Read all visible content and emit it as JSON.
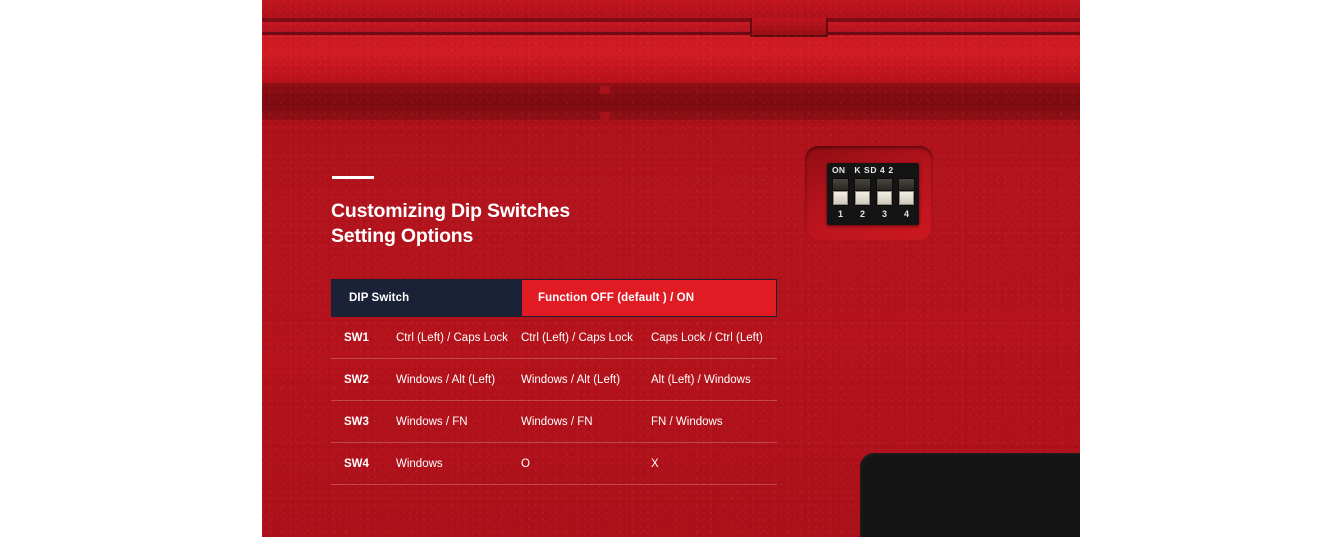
{
  "product": {
    "surface_color": "#b5121b",
    "accent_red": "#e01b24",
    "header_navy": "#1b2137"
  },
  "section": {
    "accent_rule": "white-rule",
    "title_line1": "Customizing Dip Switches",
    "title_line2": "Setting Options"
  },
  "table": {
    "headers": {
      "col_dip": "DIP Switch",
      "col_function": "Function OFF (default ) / ON"
    },
    "rows": [
      {
        "switch": "SW1",
        "label": "Ctrl (Left) / Caps Lock",
        "off": "Ctrl (Left) / Caps Lock",
        "on": "Caps Lock / Ctrl (Left)"
      },
      {
        "switch": "SW2",
        "label": "Windows  / Alt (Left)",
        "off": "Windows / Alt (Left)",
        "on": "Alt (Left) / Windows"
      },
      {
        "switch": "SW3",
        "label": "Windows / FN",
        "off": "Windows / FN",
        "on": "FN / Windows"
      },
      {
        "switch": "SW4",
        "label": "Windows",
        "off": "O",
        "on": "X"
      }
    ]
  },
  "dip_module": {
    "on_label": "ON",
    "code_label": "K SD 4 2",
    "switches": [
      {
        "number": "1",
        "position": "off"
      },
      {
        "number": "2",
        "position": "off"
      },
      {
        "number": "3",
        "position": "off"
      },
      {
        "number": "4",
        "position": "off"
      }
    ]
  }
}
